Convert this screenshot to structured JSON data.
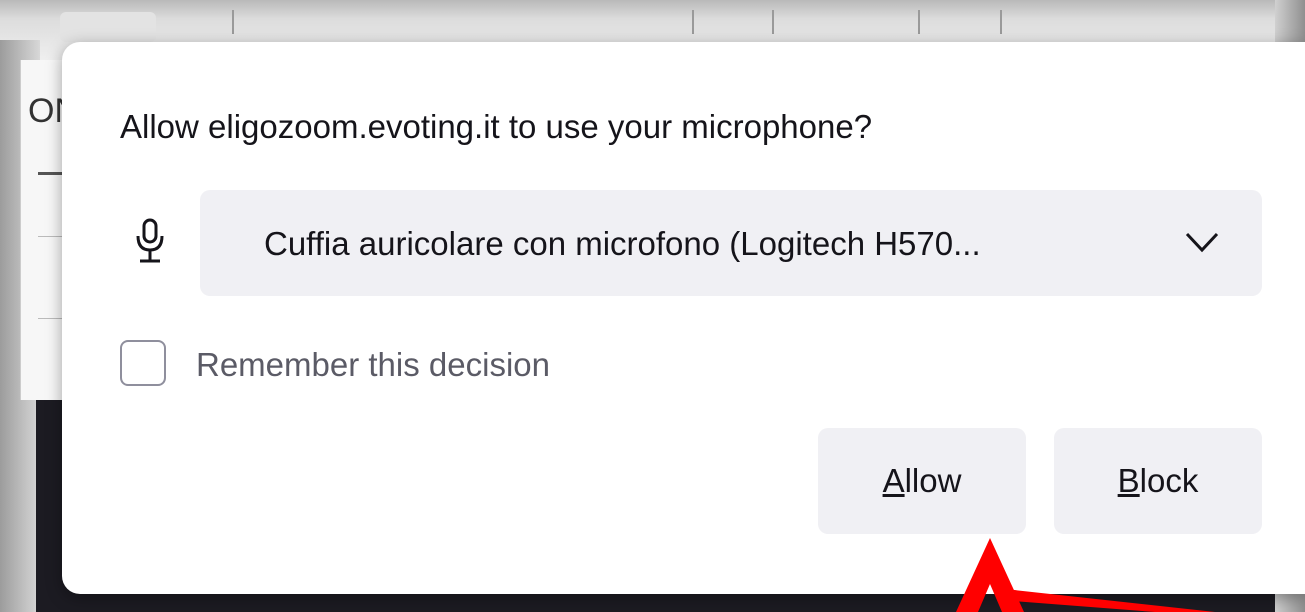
{
  "background": {
    "page_partial_text": "ON"
  },
  "prompt": {
    "title": "Allow eligozoom.evoting.it to use your microphone?",
    "device_icon": "microphone-icon",
    "device_selected": "Cuffia auricolare con microfono (Logitech H570...",
    "remember_label": "Remember this decision",
    "remember_checked": false,
    "allow_access_key": "A",
    "allow_rest": "llow",
    "block_access_key": "B",
    "block_rest": "lock"
  },
  "annotation": {
    "arrow_color": "#ff0000"
  }
}
